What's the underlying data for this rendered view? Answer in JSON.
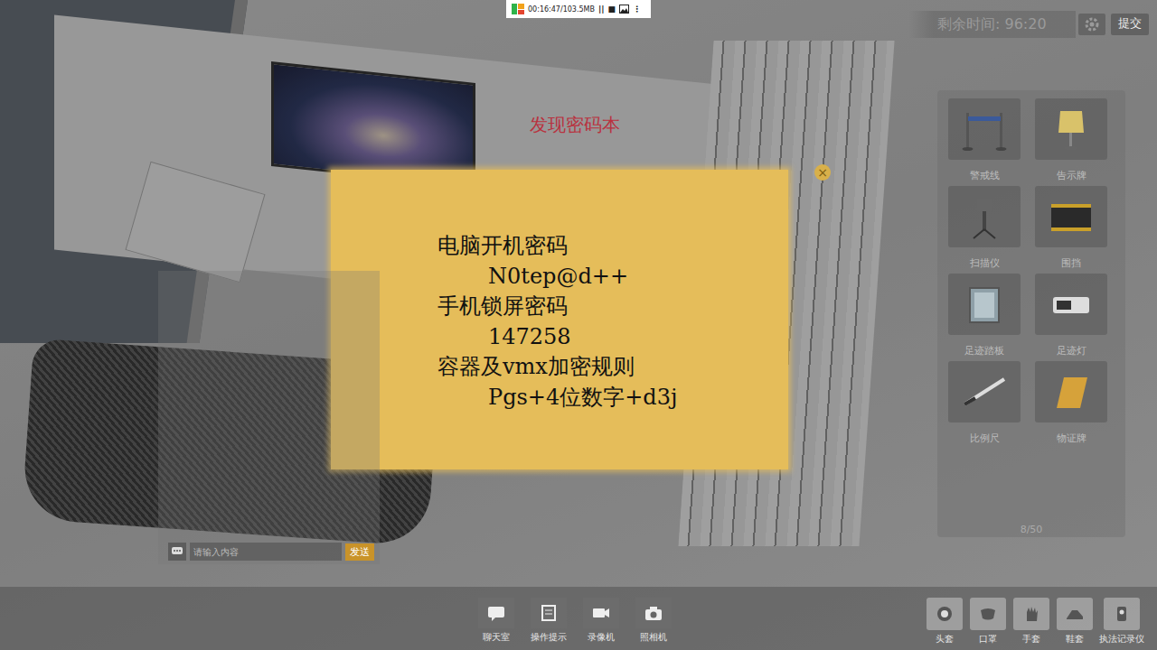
{
  "recorder": {
    "time": "00:16:47/103.5MB",
    "controls": [
      "||",
      "■",
      "⋮"
    ]
  },
  "timer": {
    "label": "剩余时间: 96:20"
  },
  "submit_button": "提交",
  "notice": "发现密码本",
  "note": {
    "close": "×",
    "lines": [
      {
        "text": "电脑开机密码",
        "kind": "heading"
      },
      {
        "text": "N0tep@d++",
        "kind": "value"
      },
      {
        "text": "手机锁屏密码",
        "kind": "heading"
      },
      {
        "text": "147258",
        "kind": "value"
      },
      {
        "text": "容器及vmx加密规则",
        "kind": "heading"
      },
      {
        "text": "Pgs+4位数字+d3j",
        "kind": "value"
      }
    ]
  },
  "tools": {
    "items": [
      {
        "label": "警戒线"
      },
      {
        "label": "告示牌"
      },
      {
        "label": "扫描仪"
      },
      {
        "label": "围挡"
      },
      {
        "label": "足迹踏板"
      },
      {
        "label": "足迹灯"
      },
      {
        "label": "比例尺"
      },
      {
        "label": "物证牌"
      }
    ],
    "count": "8/50"
  },
  "chat": {
    "placeholder": "请输入内容",
    "send": "发送"
  },
  "toolbar": [
    {
      "label": "聊天室"
    },
    {
      "label": "操作提示"
    },
    {
      "label": "录像机"
    },
    {
      "label": "照相机"
    }
  ],
  "equipment": [
    {
      "label": "头套"
    },
    {
      "label": "口罩"
    },
    {
      "label": "手套"
    },
    {
      "label": "鞋套"
    },
    {
      "label": "执法记录仪"
    }
  ]
}
